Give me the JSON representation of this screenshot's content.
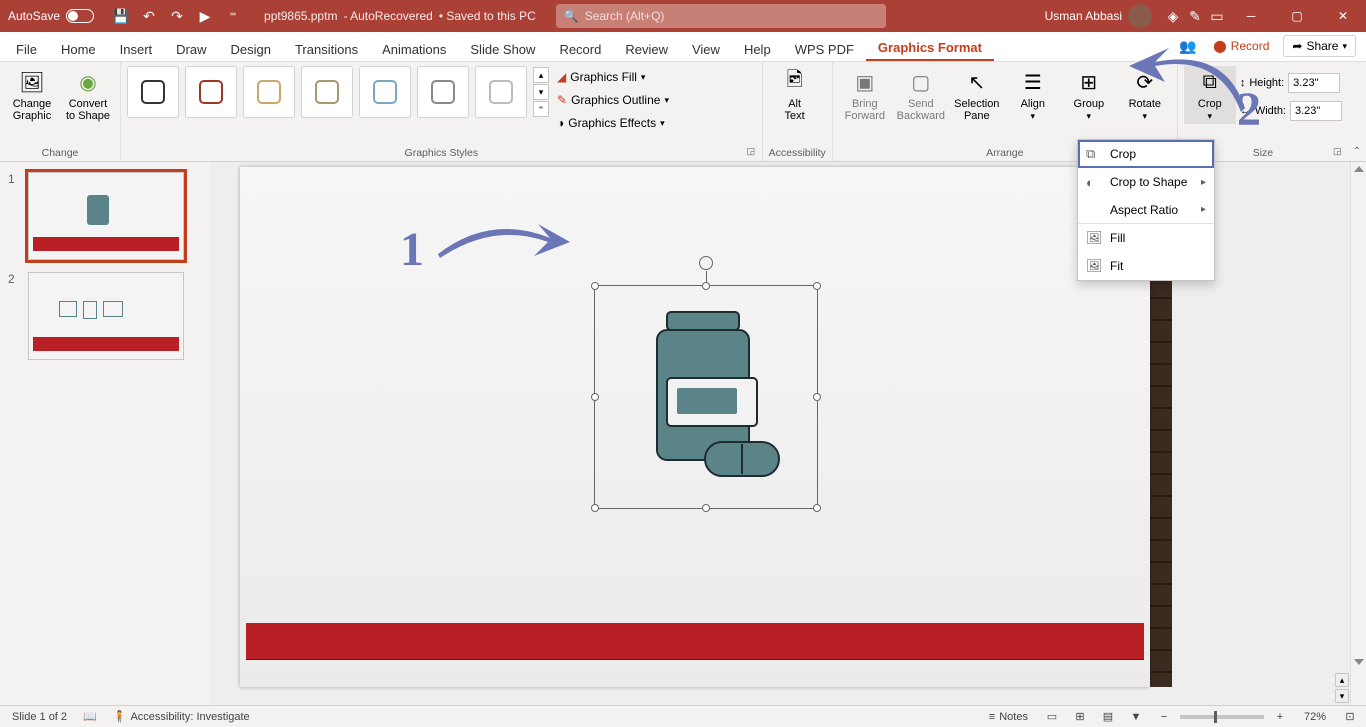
{
  "titlebar": {
    "autosave": "AutoSave",
    "filename": "ppt9865.pptm",
    "recovered": "- AutoRecovered",
    "saved": "• Saved to this PC",
    "search_placeholder": "Search (Alt+Q)",
    "username": "Usman Abbasi"
  },
  "tabs": [
    "File",
    "Home",
    "Insert",
    "Draw",
    "Design",
    "Transitions",
    "Animations",
    "Slide Show",
    "Record",
    "Review",
    "View",
    "Help",
    "WPS PDF",
    "Graphics Format"
  ],
  "active_tab": "Graphics Format",
  "right_buttons": {
    "record": "Record",
    "share": "Share"
  },
  "ribbon": {
    "change": {
      "label": "Change",
      "change_graphic": "Change\nGraphic",
      "convert": "Convert\nto Shape"
    },
    "styles": {
      "label": "Graphics Styles",
      "fill": "Graphics Fill",
      "outline": "Graphics Outline",
      "effects": "Graphics Effects"
    },
    "accessibility": {
      "label": "Accessibility",
      "alt": "Alt\nText"
    },
    "arrange": {
      "label": "Arrange",
      "bring": "Bring\nForward",
      "send": "Send\nBackward",
      "selection": "Selection\nPane",
      "align": "Align",
      "group": "Group",
      "rotate": "Rotate"
    },
    "size": {
      "label": "Size",
      "crop": "Crop",
      "height_label": "Height:",
      "width_label": "Width:",
      "height_value": "3.23\"",
      "width_value": "3.23\""
    }
  },
  "crop_menu": {
    "crop": "Crop",
    "crop_shape": "Crop to Shape",
    "aspect": "Aspect Ratio",
    "fill": "Fill",
    "fit": "Fit"
  },
  "annotations": {
    "one": "1",
    "two": "2"
  },
  "status": {
    "slide": "Slide 1 of 2",
    "accessibility": "Accessibility: Investigate",
    "notes": "Notes",
    "zoom": "72%"
  },
  "thumbs": [
    {
      "num": "1"
    },
    {
      "num": "2"
    }
  ]
}
